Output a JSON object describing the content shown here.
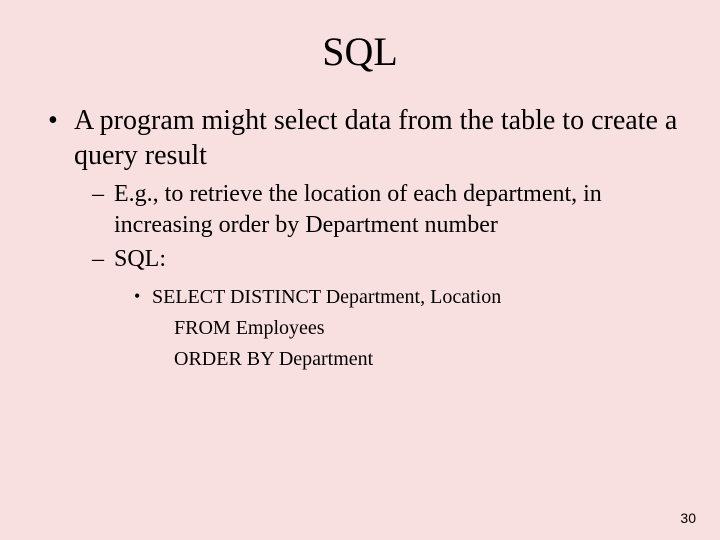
{
  "title": "SQL",
  "bullets": {
    "l1": "A program might select data from the table to create a query result",
    "l2a": "E.g., to retrieve the location of each department, in increasing order by Department number",
    "l2b": "SQL:",
    "l3a": "SELECT DISTINCT Department, Location",
    "l3b": " FROM Employees",
    "l3c": " ORDER BY Department"
  },
  "page_number": "30"
}
